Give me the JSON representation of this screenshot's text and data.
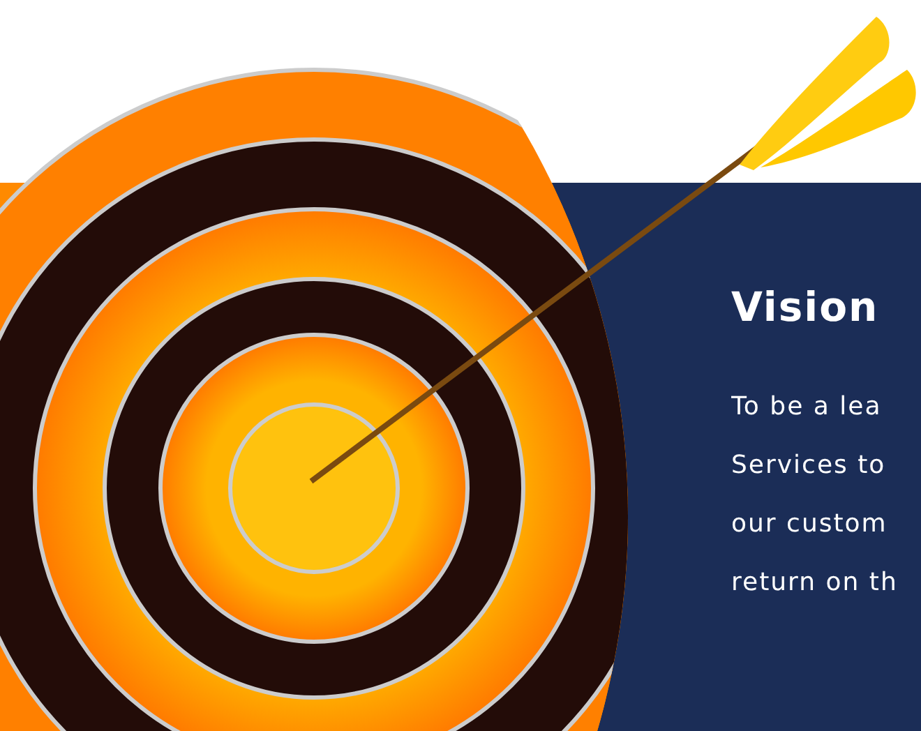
{
  "section": {
    "heading": "Vision",
    "body_lines": [
      "To be a lea",
      "Services to",
      "our custom",
      "return on th"
    ]
  }
}
